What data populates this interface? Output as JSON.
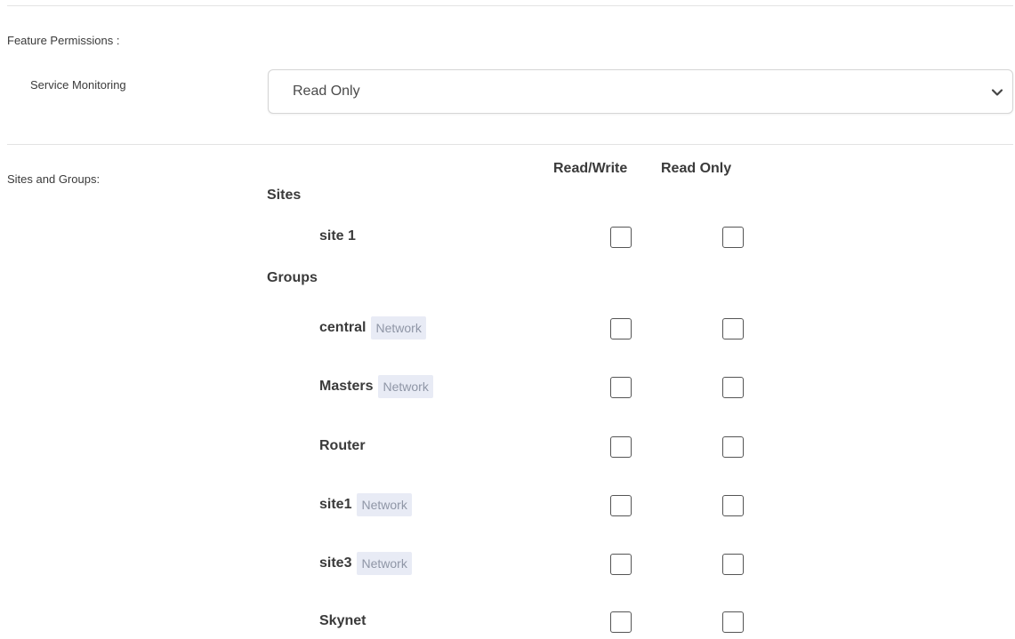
{
  "feature_permissions": {
    "label": "Feature Permissions :",
    "rows": [
      {
        "label": "Service Monitoring",
        "selected": "Read Only"
      }
    ]
  },
  "sites_and_groups": {
    "label": "Sites and Groups:",
    "columns": {
      "read_write": "Read/Write",
      "read_only": "Read Only"
    },
    "sites_heading": "Sites",
    "groups_heading": "Groups",
    "sites": [
      {
        "name": "site 1",
        "badge": "",
        "read_write": false,
        "read_only": false
      }
    ],
    "groups": [
      {
        "name": "central",
        "badge": "Network",
        "read_write": false,
        "read_only": false
      },
      {
        "name": "Masters",
        "badge": "Network",
        "read_write": false,
        "read_only": false
      },
      {
        "name": "Router",
        "badge": "",
        "read_write": false,
        "read_only": false
      },
      {
        "name": "site1",
        "badge": "Network",
        "read_write": false,
        "read_only": false
      },
      {
        "name": "site3",
        "badge": "Network",
        "read_write": false,
        "read_only": false
      },
      {
        "name": "Skynet",
        "badge": "",
        "read_write": false,
        "read_only": false
      }
    ]
  },
  "icons": {
    "select_chevron": "chevron-down-icon"
  },
  "colors": {
    "badge_bg": "#e8ebf5",
    "badge_text": "#8f96a6",
    "divider": "#e3e3e3",
    "checkbox_border": "#555555"
  }
}
